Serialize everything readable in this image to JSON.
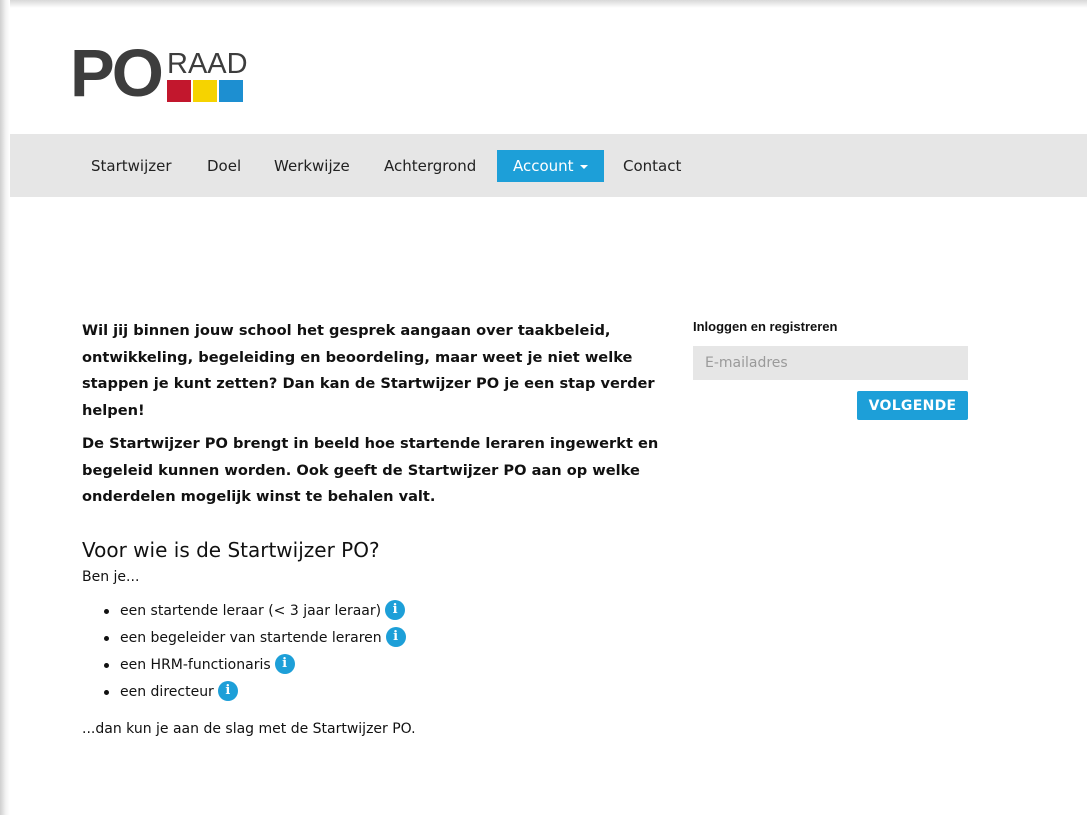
{
  "brand": {
    "logo_main": "PO",
    "logo_sub": "RAAD",
    "block_colors": [
      "#c2172d",
      "#f6d300",
      "#1d8fd1"
    ],
    "text_color": "#3d3d3d"
  },
  "nav": {
    "items": [
      {
        "label": "Startwijzer"
      },
      {
        "label": "Doel"
      },
      {
        "label": "Werkwijze"
      },
      {
        "label": "Achtergrond"
      },
      {
        "label": "Account",
        "active": true,
        "dropdown": true
      },
      {
        "label": "Contact"
      }
    ]
  },
  "intro": {
    "paragraph1": "Wil jij binnen jouw school het gesprek aangaan over taakbeleid, ontwikkeling, begeleiding en beoordeling, maar weet je niet welke stappen je kunt zetten? Dan kan de Startwijzer PO je een stap verder helpen!",
    "paragraph2": "De Startwijzer PO brengt in beeld hoe startende leraren ingewerkt en begeleid kunnen worden. Ook geeft de Startwijzer PO aan op welke onderdelen mogelijk winst te behalen valt."
  },
  "audience": {
    "title": "Voor wie is de Startwijzer PO?",
    "lead": "Ben je...",
    "items": [
      {
        "label": "een startende leraar (< 3 jaar leraar)"
      },
      {
        "label": "een begeleider van startende leraren"
      },
      {
        "label": "een HRM-functionaris"
      },
      {
        "label": "een directeur"
      }
    ],
    "info_icon": "i",
    "outro": "...dan kun je aan de slag met de Startwijzer PO."
  },
  "login": {
    "title": "Inloggen en registreren",
    "email_placeholder": "E-mailadres",
    "email_value": "",
    "next_label": "VOLGENDE"
  },
  "colors": {
    "accent": "#1d9fd8",
    "navbar_bg": "#e6e6e6"
  }
}
